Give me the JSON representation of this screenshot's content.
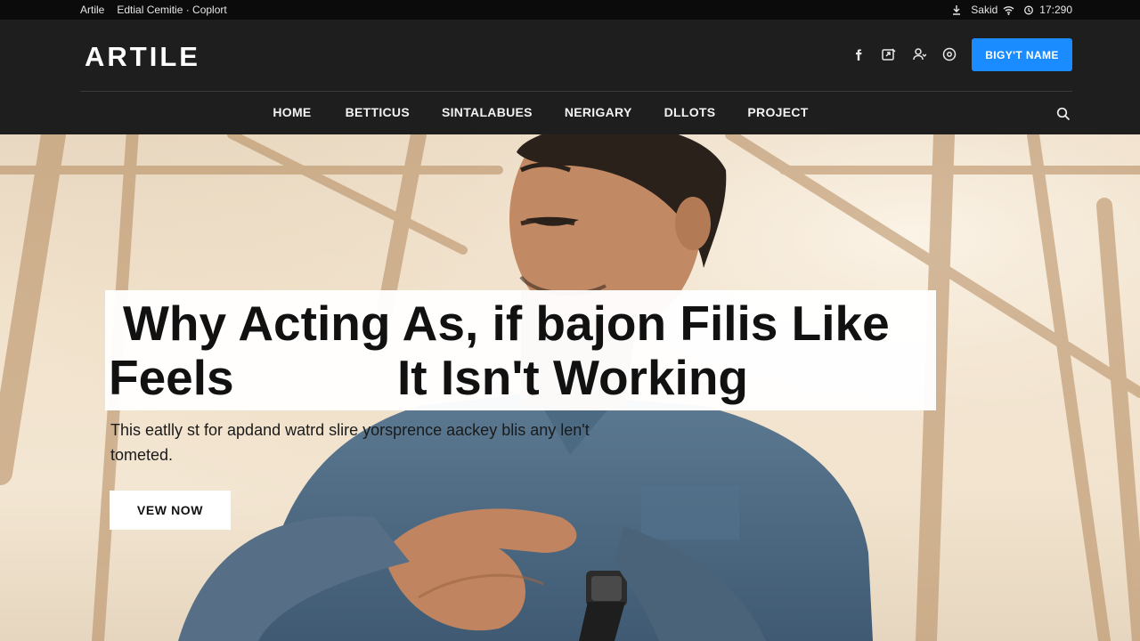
{
  "topbar": {
    "links": [
      "Artile",
      "Edtial Cemitie · Coplort"
    ],
    "status_text": "Sakid",
    "time": "17:290"
  },
  "header": {
    "logo": "ARTILE",
    "cta_label": "BIGY'T NAME",
    "nav": [
      "HOME",
      "BETTICUS",
      "SINTALABUES",
      "NERIGARY",
      "DLLOTS",
      "PROJECT"
    ],
    "social_icons": [
      "facebook-icon",
      "share-icon",
      "users-icon",
      "settings-icon"
    ]
  },
  "hero": {
    "title_line1": "Why Acting As, if bajon Filis Like",
    "title_line2": "Feels            It Isn't Working",
    "subtitle": "This eatlly st for apdand watrd slire yorsprence aackey blis any len't tometed.",
    "button_label": "VEW NOW"
  },
  "colors": {
    "accent": "#1a8cff",
    "header_bg": "#1e1e1e",
    "topbar_bg": "#0b0b0b"
  }
}
